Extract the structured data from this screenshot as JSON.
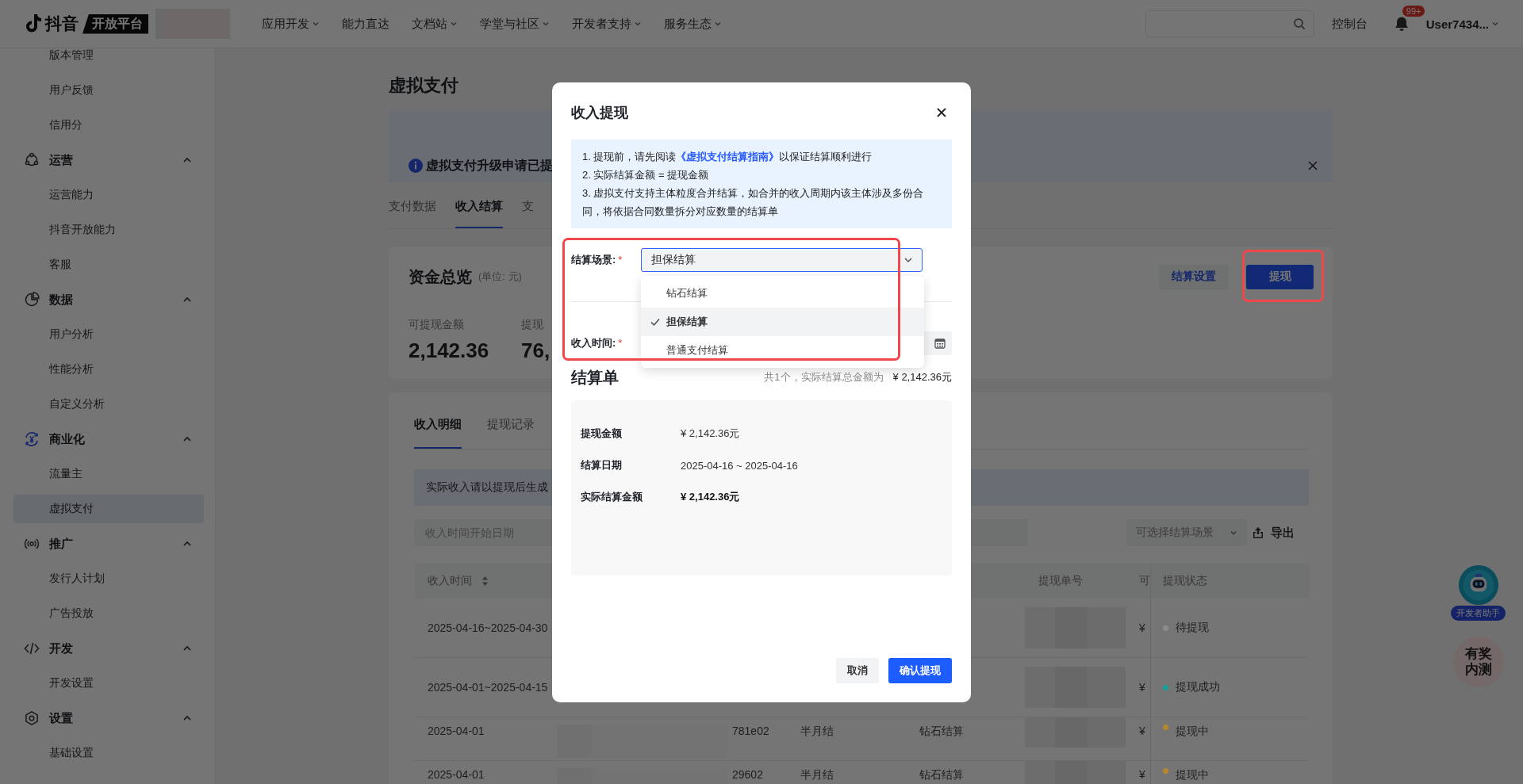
{
  "topbar": {
    "logo": "抖音",
    "logo_tag": "开放平台",
    "nav": [
      {
        "label": "应用开发",
        "has_menu": true
      },
      {
        "label": "能力直达",
        "has_menu": false
      },
      {
        "label": "文档站",
        "has_menu": true
      },
      {
        "label": "学堂与社区",
        "has_menu": true
      },
      {
        "label": "开发者支持",
        "has_menu": true
      },
      {
        "label": "服务生态",
        "has_menu": true
      }
    ],
    "console": "控制台",
    "notification_badge": "99+",
    "user": "User7434..."
  },
  "sidebar": {
    "items": [
      {
        "kind": "item",
        "label": "版本管理",
        "selected": false
      },
      {
        "kind": "item",
        "label": "用户反馈",
        "selected": false
      },
      {
        "kind": "item",
        "label": "信用分",
        "selected": false
      },
      {
        "kind": "group",
        "label": "运营",
        "expanded": true,
        "children": [
          {
            "label": "运营能力",
            "selected": false
          },
          {
            "label": "抖音开放能力",
            "selected": false
          },
          {
            "label": "客服",
            "selected": false
          }
        ]
      },
      {
        "kind": "group",
        "label": "数据",
        "expanded": true,
        "children": [
          {
            "label": "用户分析",
            "selected": false
          },
          {
            "label": "性能分析",
            "selected": false
          },
          {
            "label": "自定义分析",
            "selected": false
          }
        ]
      },
      {
        "kind": "group",
        "label": "商业化",
        "expanded": true,
        "children": [
          {
            "label": "流量主",
            "selected": false
          },
          {
            "label": "虚拟支付",
            "selected": true
          }
        ]
      },
      {
        "kind": "group",
        "label": "推广",
        "expanded": true,
        "children": [
          {
            "label": "发行人计划",
            "selected": false
          },
          {
            "label": "广告投放",
            "selected": false
          }
        ]
      },
      {
        "kind": "group",
        "label": "开发",
        "expanded": true,
        "children": [
          {
            "label": "开发设置",
            "selected": false
          }
        ]
      },
      {
        "kind": "group",
        "label": "设置",
        "expanded": true,
        "children": [
          {
            "label": "基础设置",
            "selected": false
          }
        ]
      }
    ]
  },
  "page": {
    "title": "虚拟支付",
    "banner": {
      "text": "虚拟支付升级申请已提"
    },
    "tabs": [
      {
        "label": "支付数据",
        "selected": false
      },
      {
        "label": "收入结算",
        "selected": true
      },
      {
        "label": "支",
        "selected": false
      }
    ],
    "overview": {
      "title": "资金总览",
      "unit": "(单位: 元)",
      "buttons": [
        {
          "label": "结算设置",
          "kind": "secondary",
          "highlighted": false
        },
        {
          "label": "提现",
          "kind": "primary",
          "highlighted": true
        }
      ],
      "stats": [
        {
          "label": "可提现金额",
          "value": "2,142.36"
        },
        {
          "label": "提现",
          "value": "76,"
        }
      ]
    },
    "details": {
      "tabs": [
        {
          "label": "收入明细",
          "selected": true
        },
        {
          "label": "提现记录",
          "selected": false
        }
      ],
      "notice": "实际收入请以提现后生成",
      "filters": {
        "start_date_placeholder": "收入时间开始日期",
        "scene_placeholder": "可选择结算场景",
        "export": "导出"
      },
      "table": {
        "columns": [
          {
            "label": "收入时间",
            "sortable": true
          },
          {
            "label": "提现单号",
            "sortable": false
          },
          {
            "label": "可",
            "sortable": false
          },
          {
            "label": "提现状态",
            "sortable": false
          }
        ],
        "rows": [
          {
            "income_time": "2025-04-16~2025-04-30",
            "column_6": "¥",
            "status": "待提现",
            "color": "#8c8c8c"
          },
          {
            "income_time": "2025-04-01~2025-04-15",
            "column_6": "¥",
            "status": "提现成功",
            "color": "#1a9c99"
          },
          {
            "income_time": "2025-04-01",
            "column_2": "781e02",
            "column_3": "半月结",
            "column_4": "钻石结算",
            "column_6": "¥",
            "status": "提现中",
            "color": "#b8862c"
          },
          {
            "income_time": "2025-04-01",
            "column_2": "29602",
            "column_3": "半月结",
            "column_4": "钻石结算",
            "column_6": "¥",
            "status": "提现中",
            "color": "#b8862c"
          }
        ]
      }
    }
  },
  "assistant": {
    "label": "开发者助手"
  },
  "beta_badge": "有奖内测",
  "dialog": {
    "title": "收入提现",
    "notes": [
      {
        "parts": [
          {
            "text": "1. 提现前，请先阅读"
          },
          {
            "text": "《虚拟支付结算指南》",
            "kind": "link"
          },
          {
            "text": "以保证结算顺利进行"
          }
        ]
      },
      {
        "parts": [
          {
            "text": "2. 实际结算金额 = 提现金额"
          }
        ]
      },
      {
        "parts": [
          {
            "text": "3. 虚拟支付支持主体粒度合并结算，如合并的收入周期内该主体涉及多份合同，将依据合同数量拆分对应数量的结算单"
          }
        ]
      }
    ],
    "scene_field": {
      "label": "结算场景:",
      "required_mark": "*",
      "value": "担保结算",
      "highlighted": true,
      "expanded": true,
      "options": [
        {
          "label": "钻石结算",
          "selected": false
        },
        {
          "label": "担保结算",
          "selected": true
        },
        {
          "label": "普通支付结算",
          "selected": false
        }
      ]
    },
    "time_field": {
      "label": "收入时间:",
      "required_mark": "*"
    },
    "statement": {
      "title": "结算单",
      "summary": "共1个，实际结算总金额为",
      "total": "¥ 2,142.36元",
      "rows": [
        {
          "label": "提现金额",
          "value": "¥ 2,142.36元",
          "emphasis": false
        },
        {
          "label": "结算日期",
          "value": "2025-04-16 ~ 2025-04-16",
          "emphasis": false
        },
        {
          "label": "实际结算金额",
          "value": "¥ 2,142.36元",
          "emphasis": true
        }
      ]
    },
    "buttons": [
      {
        "label": "取消",
        "kind": "secondary"
      },
      {
        "label": "确认提现",
        "kind": "primary"
      }
    ]
  }
}
